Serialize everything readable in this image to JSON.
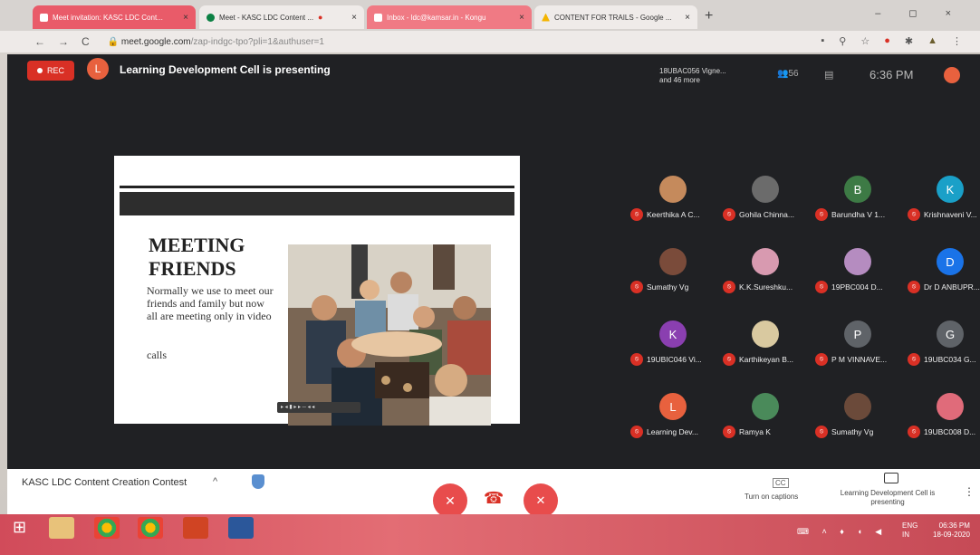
{
  "browser": {
    "tabs": [
      {
        "label": "Meet invitation: KASC LDC Cont...",
        "close": "×"
      },
      {
        "label": "Meet - KASC LDC Content ...",
        "close": "×"
      },
      {
        "label": "Inbox - ldc@kamsar.in - Kongu",
        "close": "×"
      },
      {
        "label": "CONTENT FOR TRAILS - Google ...",
        "close": "×"
      }
    ],
    "new_tab": "+",
    "window_controls": "– ◻ ×",
    "url_host": "meet.google.com",
    "url_path": "/zap-indgc-tpo?pli=1&authuser=1",
    "nav": {
      "back": "←",
      "forward": "→",
      "reload": "C"
    }
  },
  "meet": {
    "rec_label": "REC",
    "presenter_initial": "L",
    "presenting_text": "Learning Development Cell is presenting",
    "pinned_line1": "18UBAC056 Vigne...",
    "pinned_line2": "and 46 more",
    "people_count": "56",
    "time": "6:36 PM"
  },
  "slide": {
    "title": "MEETING\nFRIENDS",
    "body": "Normally we use to meet our friends and family but now all are meeting only in video",
    "calls": "calls",
    "photo_toolbar": "▸ ◂ ▮ ▸ ▸ ─ ◂ ◂"
  },
  "participants": [
    {
      "name": "Keerthika A C...",
      "initial": "",
      "color": "#c58a5c"
    },
    {
      "name": "Gohila Chinna...",
      "initial": "",
      "color": "#6b6b6b"
    },
    {
      "name": "Barundha V 1...",
      "initial": "B",
      "color": "#3d7a45"
    },
    {
      "name": "Krishnaveni V...",
      "initial": "K",
      "color": "#1aa0c8"
    },
    {
      "name": "Sumathy Vg",
      "initial": "",
      "color": "#7a4b3a"
    },
    {
      "name": "K.K.Sureshku...",
      "initial": "",
      "color": "#d89ab0"
    },
    {
      "name": "19PBC004 D...",
      "initial": "",
      "color": "#b58cc0"
    },
    {
      "name": "Dr D ANBUPR...",
      "initial": "D",
      "color": "#1a73e8"
    },
    {
      "name": "19UBIC046 Vi...",
      "initial": "K",
      "color": "#8a3fb0"
    },
    {
      "name": "Karthikeyan B...",
      "initial": "",
      "color": "#d9c9a0"
    },
    {
      "name": "P M VINNAVE...",
      "initial": "P",
      "color": "#5f6368"
    },
    {
      "name": "19UBC034 G...",
      "initial": "G",
      "color": "#5f6368"
    },
    {
      "name": "Learning Dev...",
      "initial": "L",
      "color": "#e8613e"
    },
    {
      "name": "Ramya K",
      "initial": "",
      "color": "#4a8a5a"
    },
    {
      "name": "Sumathy Vg",
      "initial": "",
      "color": "#6b4a3a"
    },
    {
      "name": "19UBC008 D...",
      "initial": "",
      "color": "#e06b7a"
    }
  ],
  "bottom": {
    "meeting_title": "KASC LDC Content Creation Contest",
    "chevron": "^",
    "mic_icon": "✕",
    "hangup_icon": "☎",
    "cam_icon": "✕",
    "cc_icon": "CC",
    "captions_label": "Turn on captions",
    "presenting_label": "Learning Development Cell is presenting",
    "more_icon": "⋮"
  },
  "taskbar": {
    "start": "⊞",
    "lang1": "ENG",
    "lang2": "IN",
    "time": "06:36 PM",
    "date": "18-09-2020",
    "tray": "⌨ ˄ ♦ ◖ ◀"
  },
  "colors": {
    "accent": "#1a73e8",
    "rec": "#d93025",
    "meet_bg": "#202124",
    "taskbar": "#d14b5a"
  }
}
